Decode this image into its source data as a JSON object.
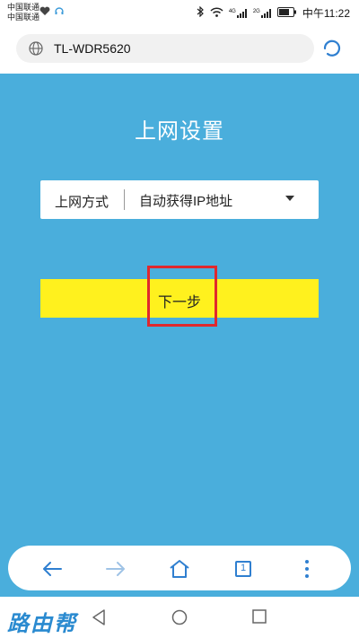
{
  "status_bar": {
    "carrier_line1": "中国联通",
    "carrier_line2": "中国联通",
    "network_badge_1": "4G",
    "network_badge_2": "2G",
    "time": "中午11:22"
  },
  "address_bar": {
    "url": "TL-WDR5620"
  },
  "page": {
    "title": "上网设置",
    "connection_type": {
      "label": "上网方式",
      "selected": "自动获得IP地址"
    },
    "next_button": "下一步"
  },
  "bottom_toolbar": {
    "tab_count": "1"
  },
  "watermark": "路由帮",
  "colors": {
    "background": "#4aaedc",
    "button": "#fff11e",
    "highlight": "#e0282d",
    "toolbar_icons": "#2f7fd0"
  }
}
